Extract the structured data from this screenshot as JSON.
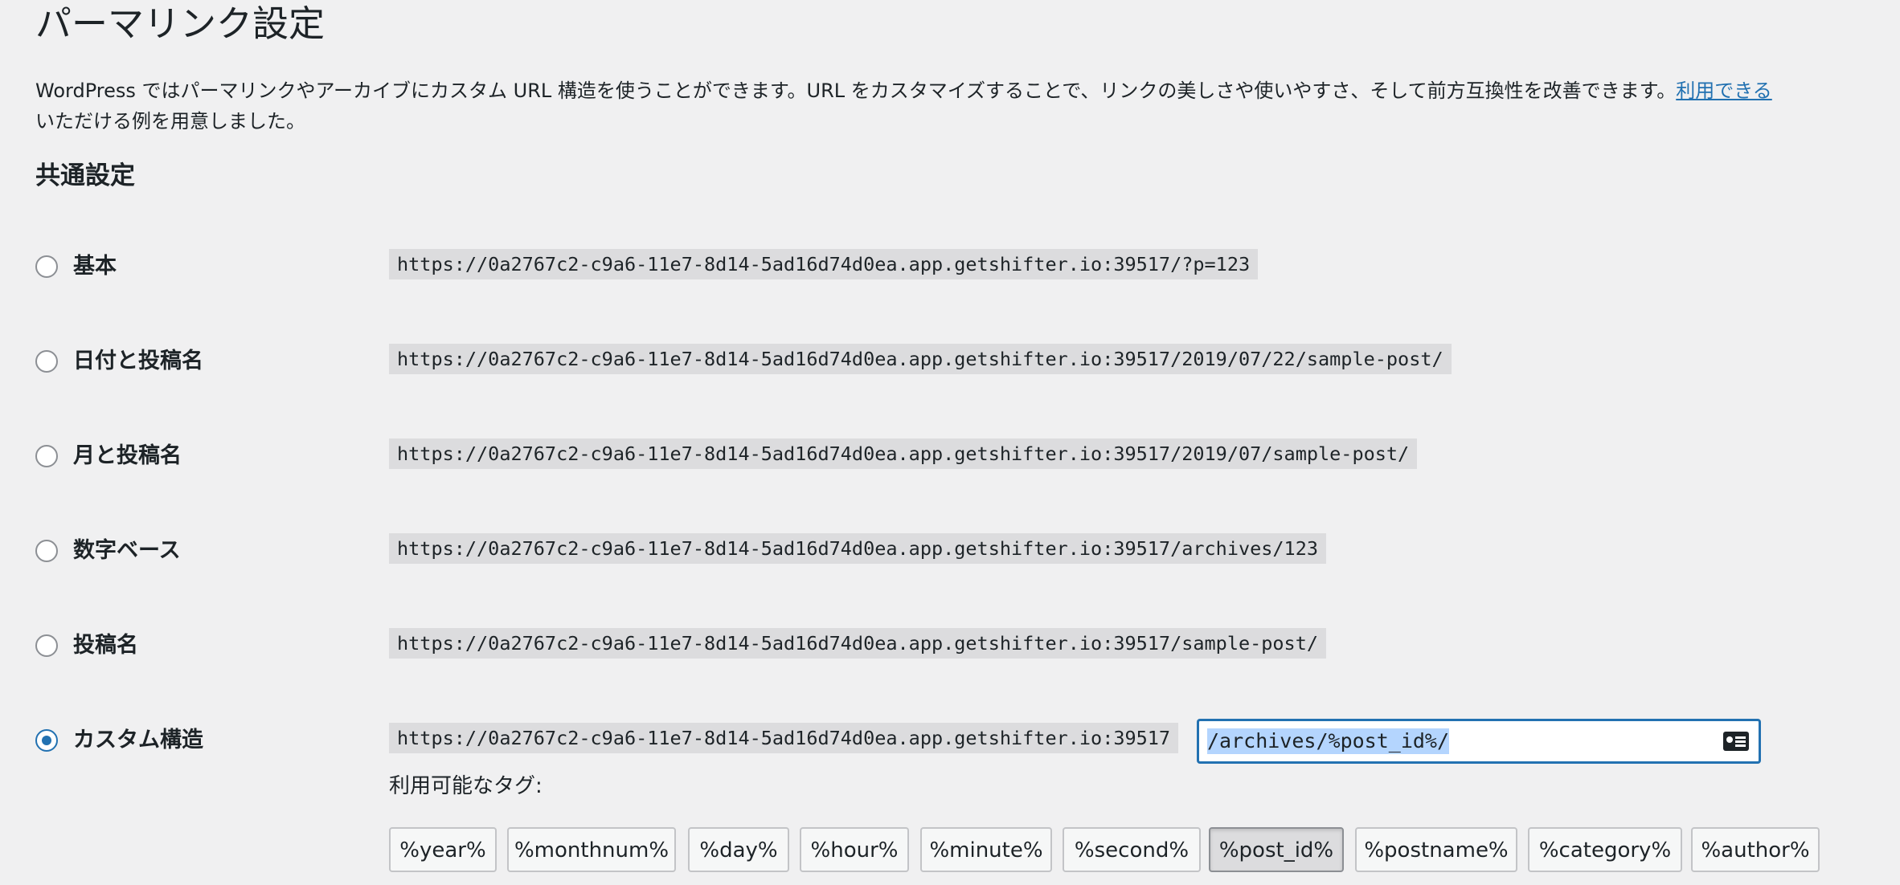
{
  "page": {
    "title": "パーマリンク設定",
    "intro_text": "WordPress ではパーマリンクやアーカイブにカスタム URL 構造を使うことができます。URL をカスタマイズすることで、リンクの美しさや使いやすさ、そして前方互換性を改善できます。",
    "intro_link": "利用できる",
    "intro_line2": "いただける例を用意しました。"
  },
  "common": {
    "heading": "共通設定",
    "options": [
      {
        "label": "基本",
        "url": "https://0a2767c2-c9a6-11e7-8d14-5ad16d74d0ea.app.getshifter.io:39517/?p=123",
        "checked": false
      },
      {
        "label": "日付と投稿名",
        "url": "https://0a2767c2-c9a6-11e7-8d14-5ad16d74d0ea.app.getshifter.io:39517/2019/07/22/sample-post/",
        "checked": false
      },
      {
        "label": "月と投稿名",
        "url": "https://0a2767c2-c9a6-11e7-8d14-5ad16d74d0ea.app.getshifter.io:39517/2019/07/sample-post/",
        "checked": false
      },
      {
        "label": "数字ベース",
        "url": "https://0a2767c2-c9a6-11e7-8d14-5ad16d74d0ea.app.getshifter.io:39517/archives/123",
        "checked": false
      },
      {
        "label": "投稿名",
        "url": "https://0a2767c2-c9a6-11e7-8d14-5ad16d74d0ea.app.getshifter.io:39517/sample-post/",
        "checked": false
      },
      {
        "label": "カスタム構造",
        "url": "https://0a2767c2-c9a6-11e7-8d14-5ad16d74d0ea.app.getshifter.io:39517",
        "checked": true
      }
    ],
    "custom_value": "/archives/%post_id%/",
    "tags_label": "利用可能なタグ:",
    "tags": [
      "%year%",
      "%monthnum%",
      "%day%",
      "%hour%",
      "%minute%",
      "%second%",
      "%post_id%",
      "%postname%",
      "%category%",
      "%author%"
    ],
    "active_tag": "%post_id%"
  },
  "colors": {
    "accent": "#2271b1",
    "background": "#f0f0f1",
    "code_bg": "#dcdcde"
  },
  "icons": {
    "custom_field_icon": "contact-card-icon"
  }
}
